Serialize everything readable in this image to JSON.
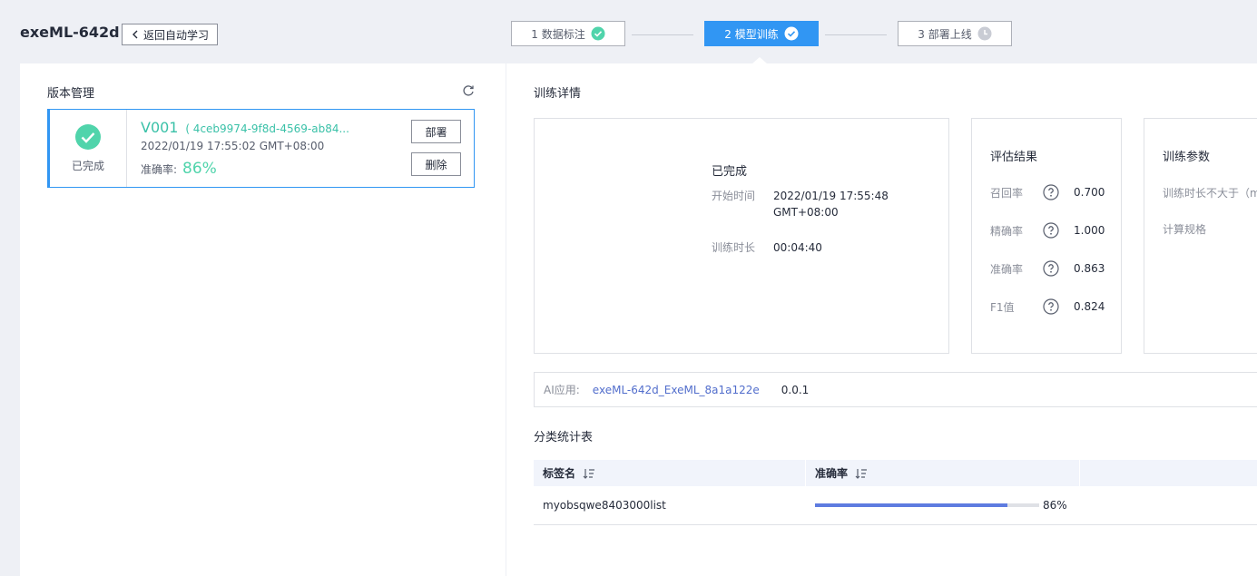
{
  "header": {
    "app_title": "exeML-642d",
    "back_label": "返回自动学习"
  },
  "steps": [
    {
      "label": "1 数据标注",
      "state": "done",
      "icon": "check-circle-icon"
    },
    {
      "label": "2 模型训练",
      "state": "active",
      "icon": "check-circle-icon"
    },
    {
      "label": "3 部署上线",
      "state": "pending",
      "icon": "clock-icon"
    }
  ],
  "version_panel": {
    "title": "版本管理",
    "refresh_icon": "refresh-icon",
    "card": {
      "status": "已完成",
      "version": "V001",
      "id": "( 4ceb9974-9f8d-4569-ab84...",
      "time": "2022/01/19 17:55:02 GMT+08:00",
      "accuracy_label": "准确率:",
      "accuracy_value": "86%",
      "deploy_label": "部署",
      "delete_label": "删除"
    }
  },
  "details": {
    "title": "训练详情",
    "status": {
      "title": "已完成",
      "start_label": "开始时间",
      "start_value_line1": "2022/01/19 17:55:48",
      "start_value_line2": "GMT+08:00",
      "duration_label": "训练时长",
      "duration_value": "00:04:40"
    },
    "eval": {
      "title": "评估结果",
      "rows": [
        {
          "label": "召回率",
          "value": "0.700"
        },
        {
          "label": "精确率",
          "value": "1.000"
        },
        {
          "label": "准确率",
          "value": "0.863"
        },
        {
          "label": "F1值",
          "value": "0.824"
        }
      ]
    },
    "params": {
      "title": "训练参数",
      "rows": [
        "训练时长不大于（m",
        "计算规格"
      ]
    },
    "ai_app": {
      "label": "AI应用:",
      "link": "exeML-642d_ExeML_8a1a122e",
      "version": "0.0.1"
    },
    "stats": {
      "title": "分类统计表",
      "headers": [
        "标签名",
        "准确率"
      ],
      "rows": [
        {
          "label": "myobsqwe8403000list",
          "accuracy": 0.86,
          "accuracy_text": "86%"
        }
      ]
    }
  },
  "colors": {
    "primary": "#3196f3",
    "success": "#50d4ab",
    "link": "#526ecc",
    "bar": "#5e7ce0"
  }
}
